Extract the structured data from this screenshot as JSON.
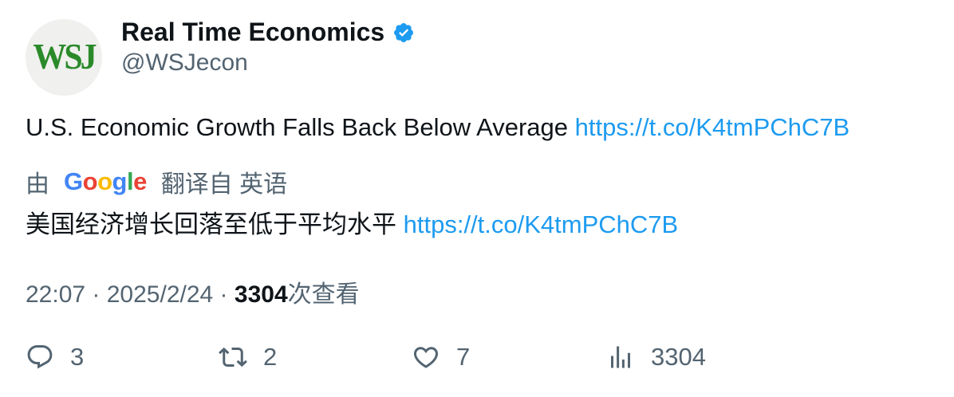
{
  "author": {
    "avatar_text": "WSJ",
    "display_name": "Real Time Economics",
    "handle": "@WSJecon",
    "verified": true
  },
  "tweet": {
    "text": "U.S. Economic Growth Falls Back Below Average ",
    "link": "https://t.co/K4tmPChC7B"
  },
  "translation": {
    "by_label": "由",
    "provider": "Google",
    "from_label": "翻译自 英语",
    "text": "美国经济增长回落至低于平均水平 ",
    "link": "https://t.co/K4tmPChC7B"
  },
  "meta": {
    "time": "22:07",
    "sep1": " · ",
    "date": "2025/2/24",
    "sep2": " · ",
    "views": "3304",
    "views_suffix": "次查看"
  },
  "actions": {
    "replies": "3",
    "retweets": "2",
    "likes": "7",
    "views": "3304"
  },
  "colors": {
    "link": "#1d9bf0",
    "secondary_text": "#536471",
    "verified_badge": "#1d9bf0"
  },
  "icons": [
    "verified-badge-icon",
    "reply-icon",
    "retweet-icon",
    "like-icon",
    "views-icon"
  ]
}
